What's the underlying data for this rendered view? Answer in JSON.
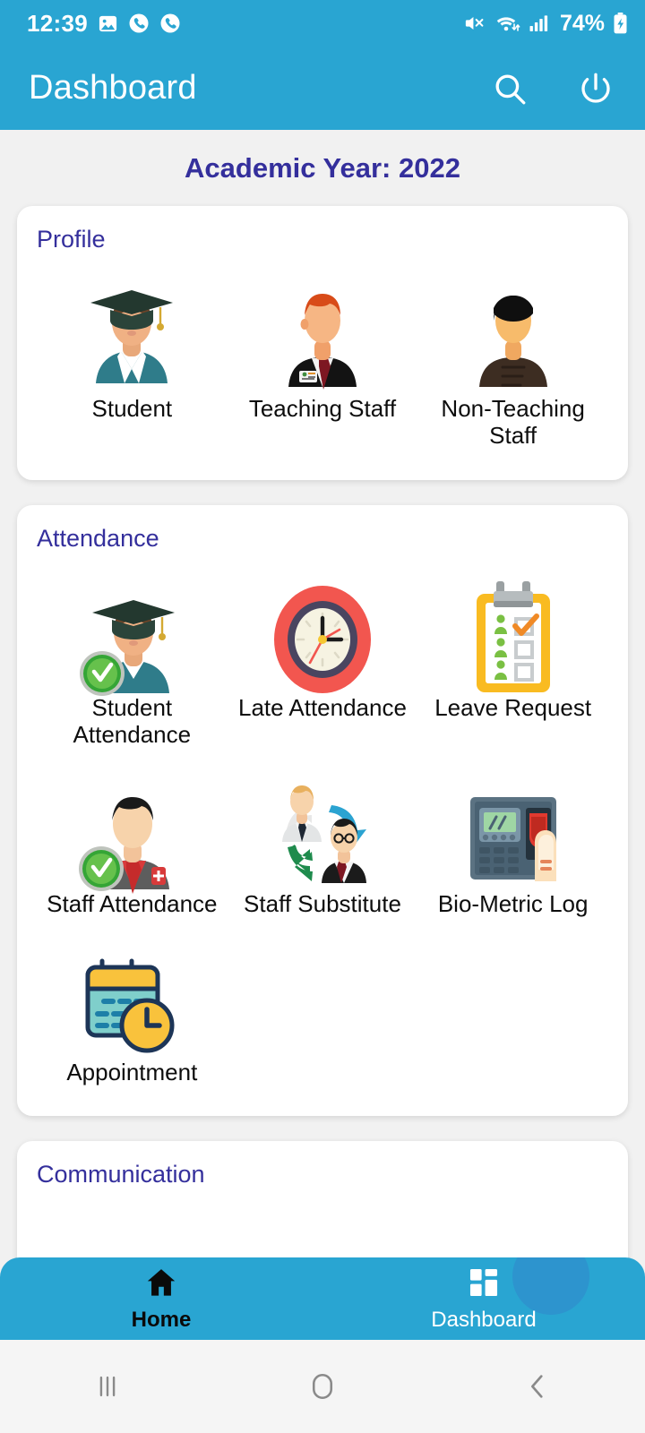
{
  "status_bar": {
    "time": "12:39",
    "battery_percent": "74%",
    "left_icons": [
      "image-icon",
      "missed-call-icon",
      "missed-call-icon"
    ],
    "right_icons": [
      "mute-icon",
      "wifi-icon",
      "signal-icon",
      "battery-charging-icon"
    ]
  },
  "app_bar": {
    "title": "Dashboard",
    "actions": [
      {
        "name": "search-icon",
        "label": "Search"
      },
      {
        "name": "power-icon",
        "label": "Logout"
      }
    ]
  },
  "academic_year": "Academic Year: 2022",
  "sections": [
    {
      "title": "Profile",
      "tiles": [
        {
          "label": "Student",
          "icon": "student-avatar-icon"
        },
        {
          "label": "Teaching Staff",
          "icon": "teaching-staff-avatar-icon"
        },
        {
          "label": "Non-Teaching Staff",
          "icon": "non-teaching-staff-avatar-icon"
        }
      ]
    },
    {
      "title": "Attendance",
      "tiles": [
        {
          "label": "Student Attendance",
          "icon": "student-check-icon"
        },
        {
          "label": "Late Attendance",
          "icon": "clock-icon"
        },
        {
          "label": "Leave Request",
          "icon": "clipboard-checklist-icon"
        },
        {
          "label": "Staff Attendance",
          "icon": "staff-check-icon"
        },
        {
          "label": "Staff Substitute",
          "icon": "staff-swap-icon"
        },
        {
          "label": "Bio-Metric Log",
          "icon": "fingerprint-device-icon"
        },
        {
          "label": "Appointment",
          "icon": "calendar-clock-icon"
        }
      ]
    },
    {
      "title": "Communication",
      "tiles": []
    }
  ],
  "bottom_nav": [
    {
      "label": "Home",
      "icon": "home-icon",
      "active": true
    },
    {
      "label": "Dashboard",
      "icon": "dashboard-grid-icon",
      "active": false
    }
  ],
  "system_nav": [
    {
      "name": "recents-button",
      "glyph": "|||"
    },
    {
      "name": "home-button",
      "glyph": "O"
    },
    {
      "name": "back-button",
      "glyph": "<"
    }
  ],
  "colors": {
    "primary": "#29a5d2",
    "heading": "#342f9c",
    "background": "#f1f1f1",
    "card": "#ffffff",
    "label": "#0d0d0d",
    "system_bar": "#f5f5f5"
  }
}
